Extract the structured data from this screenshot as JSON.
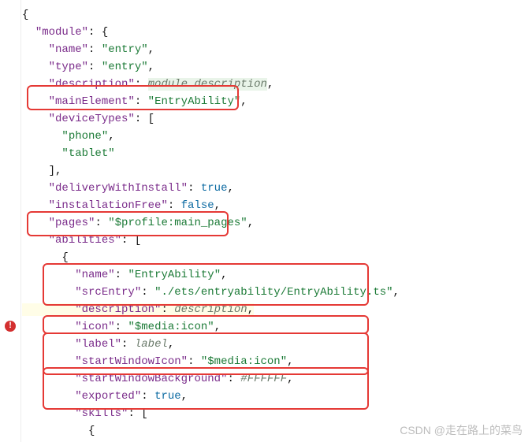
{
  "code": {
    "module": {
      "key": "module",
      "name": {
        "k": "name",
        "v": "entry"
      },
      "type": {
        "k": "type",
        "v": "entry"
      },
      "description": {
        "k": "description",
        "v": "module description"
      },
      "mainElement": {
        "k": "mainElement",
        "v": "EntryAbility"
      },
      "deviceTypes": {
        "k": "deviceTypes",
        "items": [
          "phone",
          "tablet"
        ]
      },
      "deliveryWithInstall": {
        "k": "deliveryWithInstall",
        "v": "true"
      },
      "installationFree": {
        "k": "installationFree",
        "v": "false"
      },
      "pages": {
        "k": "pages",
        "v": "$profile:main_pages"
      },
      "abilities": {
        "k": "abilities",
        "item": {
          "name": {
            "k": "name",
            "v": "EntryAbility"
          },
          "srcEntry": {
            "k": "srcEntry",
            "v": "./ets/entryability/EntryAbility.ts"
          },
          "description": {
            "k": "description",
            "v": "description"
          },
          "icon": {
            "k": "icon",
            "v": "$media:icon"
          },
          "label": {
            "k": "label",
            "v": "label"
          },
          "startWindowIcon": {
            "k": "startWindowIcon",
            "v": "$media:icon"
          },
          "startWindowBackground": {
            "k": "startWindowBackground",
            "v": "#FFFFFF"
          },
          "exported": {
            "k": "exported",
            "v": "true"
          },
          "skills": {
            "k": "skills"
          }
        }
      }
    }
  },
  "watermark": "CSDN @走在路上的菜鸟"
}
